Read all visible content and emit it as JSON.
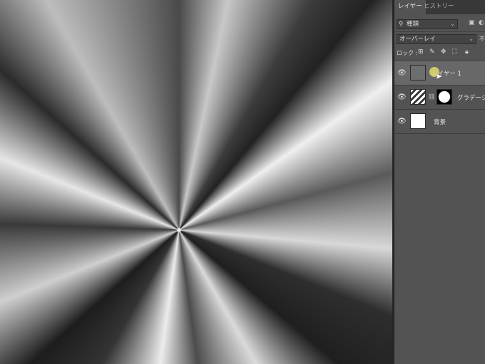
{
  "tabs": [
    "レイヤー",
    "ヒストリー"
  ],
  "filter": {
    "search_icon": "search-icon",
    "kind_label": "種類"
  },
  "blend_mode": {
    "value": "オーバーレイ",
    "opacity_label": "不"
  },
  "lock": {
    "label": "ロック :"
  },
  "layers": [
    {
      "name": "レイヤー 1",
      "visible": true,
      "selected": true,
      "thumb": "gray"
    },
    {
      "name": "グラデーシ",
      "visible": true,
      "selected": false,
      "thumb": "gradient-with-mask"
    },
    {
      "name": "背景",
      "visible": true,
      "selected": false,
      "thumb": "white"
    }
  ],
  "colors": {
    "panel_bg": "#535353",
    "selected_layer_bg": "#686868",
    "tab_bar_bg": "#383838"
  }
}
